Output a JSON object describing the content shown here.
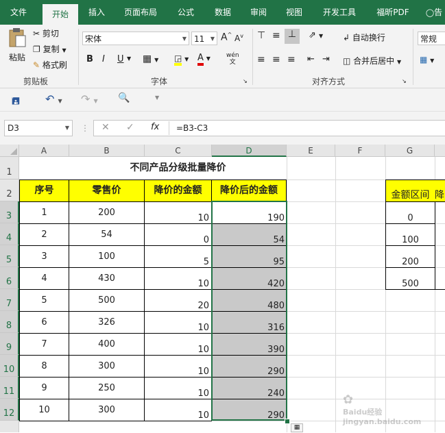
{
  "ribbon_tabs": [
    "文件",
    "开始",
    "插入",
    "页面布局",
    "公式",
    "数据",
    "审阅",
    "视图",
    "开发工具",
    "福昕PDF",
    "告"
  ],
  "active_tab": "开始",
  "clipboard": {
    "paste": "粘贴",
    "cut": "剪切",
    "copy": "复制",
    "format_painter": "格式刷",
    "group_label": "剪贴板"
  },
  "font": {
    "name": "宋体",
    "size": "11",
    "group_label": "字体",
    "bold": "B",
    "italic": "I",
    "underline": "U",
    "grow": "A",
    "shrink": "A",
    "phonetic": "wén"
  },
  "alignment": {
    "wrap": "自动换行",
    "merge": "合并后居中",
    "group_label": "对齐方式"
  },
  "number": {
    "format": "常规"
  },
  "formula_bar": {
    "name_box": "D3",
    "fx": "fx",
    "formula": "=B3-C3"
  },
  "columns": [
    "A",
    "B",
    "C",
    "D",
    "E",
    "F",
    "G"
  ],
  "rows": [
    "1",
    "2",
    "3",
    "4",
    "5",
    "6",
    "7",
    "8",
    "9",
    "10",
    "11",
    "12"
  ],
  "sheet_title": "不同产品分级批量降价",
  "table_headers": [
    "序号",
    "零售价",
    "降价的金额",
    "降价后的金额"
  ],
  "table_rows": [
    {
      "seq": "1",
      "price": "200",
      "discount": "10",
      "final": "190"
    },
    {
      "seq": "2",
      "price": "54",
      "discount": "0",
      "final": "54"
    },
    {
      "seq": "3",
      "price": "100",
      "discount": "5",
      "final": "95"
    },
    {
      "seq": "4",
      "price": "430",
      "discount": "10",
      "final": "420"
    },
    {
      "seq": "5",
      "price": "500",
      "discount": "20",
      "final": "480"
    },
    {
      "seq": "6",
      "price": "326",
      "discount": "10",
      "final": "316"
    },
    {
      "seq": "7",
      "price": "400",
      "discount": "10",
      "final": "390"
    },
    {
      "seq": "8",
      "price": "300",
      "discount": "10",
      "final": "290"
    },
    {
      "seq": "9",
      "price": "250",
      "discount": "10",
      "final": "240"
    },
    {
      "seq": "10",
      "price": "300",
      "discount": "10",
      "final": "290"
    }
  ],
  "side_table": {
    "header": "金额区间",
    "header2": "降",
    "values": [
      "0",
      "100",
      "200",
      "500"
    ]
  },
  "watermark": "Baidu经验 jingyan.baidu.com",
  "colors": {
    "accent": "#217346",
    "header_fill": "#ffff00",
    "selection": "#c9c9c9"
  }
}
